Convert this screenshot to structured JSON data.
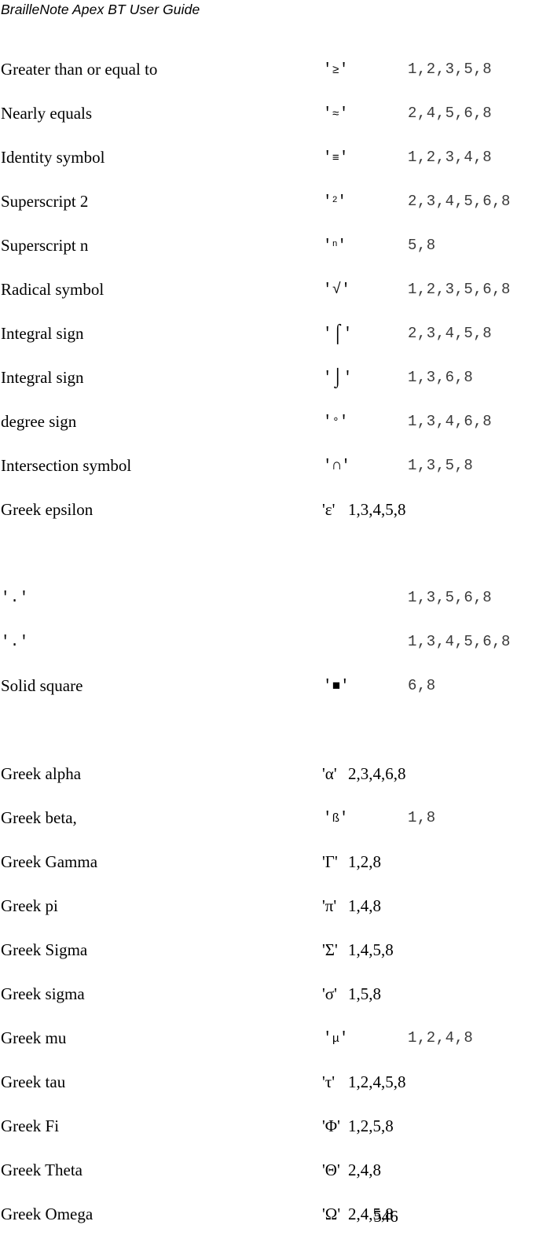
{
  "header": {
    "title": "BrailleNote Apex BT User Guide"
  },
  "page_number": "546",
  "rows": [
    {
      "description": "Greater than or equal to",
      "symbol": "≥",
      "dots": "1,2,3,5,8",
      "style": "mono",
      "glyph_class": "glyph"
    },
    {
      "description": "Nearly equals",
      "symbol": "≈",
      "dots": "2,4,5,6,8",
      "style": "mono",
      "glyph_class": "glyph"
    },
    {
      "description": "Identity symbol",
      "symbol": "≡",
      "dots": "1,2,3,4,8",
      "style": "mono",
      "glyph_class": "glyph"
    },
    {
      "description": "Superscript 2",
      "symbol": "2",
      "dots": "2,3,4,5,6,8",
      "style": "mono",
      "glyph_class": "glyph sup"
    },
    {
      "description": "Superscript n",
      "symbol": "n",
      "dots": "5,8",
      "style": "mono",
      "glyph_class": "glyph sup"
    },
    {
      "description": "Radical symbol",
      "symbol": "√",
      "dots": "1,2,3,5,6,8",
      "style": "mono",
      "glyph_class": "glyph big"
    },
    {
      "description": "Integral sign",
      "symbol": "⌠",
      "dots": "2,3,4,5,8",
      "style": "mono",
      "glyph_class": "glyph tall"
    },
    {
      "description": "Integral sign",
      "symbol": "⌡",
      "dots": "1,3,6,8",
      "style": "mono",
      "glyph_class": "glyph tall"
    },
    {
      "description": "degree sign",
      "symbol": "°",
      "dots": "1,3,4,6,8",
      "style": "mono",
      "glyph_class": "glyph"
    },
    {
      "description": "Intersection symbol",
      "symbol": "∩",
      "dots": "1,3,5,8",
      "style": "mono",
      "glyph_class": "glyph big"
    },
    {
      "description": "Greek epsilon",
      "symbol": "ε",
      "dots": "1,3,4,5,8",
      "style": "serif",
      "glyph_class": "glyph"
    },
    {
      "description": "",
      "symbol": "",
      "dots": "",
      "style": "spacer",
      "glyph_class": ""
    },
    {
      "description": "'.'",
      "symbol": "",
      "dots": "1,3,5,6,8",
      "style": "mono-left",
      "glyph_class": ""
    },
    {
      "description": "'.'",
      "symbol": "",
      "dots": "1,3,4,5,6,8",
      "style": "mono-left",
      "glyph_class": ""
    },
    {
      "description": "Solid square",
      "symbol": "■",
      "dots": "6,8",
      "style": "mono",
      "glyph_class": "glyph sq"
    },
    {
      "description": "",
      "symbol": "",
      "dots": "",
      "style": "spacer",
      "glyph_class": ""
    },
    {
      "description": "Greek alpha",
      "symbol": "α",
      "dots": "2,3,4,6,8",
      "style": "serif",
      "glyph_class": "glyph"
    },
    {
      "description": "Greek beta,",
      "symbol": "ß",
      "dots": "1,8",
      "style": "mono",
      "glyph_class": "glyph"
    },
    {
      "description": "Greek Gamma",
      "symbol": "Γ",
      "dots": "1,2,8",
      "style": "serif",
      "glyph_class": "glyph"
    },
    {
      "description": "Greek pi",
      "symbol": "π",
      "dots": "1,4,8",
      "style": "serif",
      "glyph_class": "glyph"
    },
    {
      "description": "Greek Sigma",
      "symbol": "Σ",
      "dots": "1,4,5,8",
      "style": "serif",
      "glyph_class": "glyph"
    },
    {
      "description": "Greek sigma",
      "symbol": "σ",
      "dots": "1,5,8",
      "style": "serif",
      "glyph_class": "glyph"
    },
    {
      "description": "Greek mu",
      "symbol": "μ",
      "dots": "1,2,4,8",
      "style": "mono",
      "glyph_class": "glyph"
    },
    {
      "description": "Greek tau",
      "symbol": "τ",
      "dots": "1,2,4,5,8",
      "style": "serif",
      "glyph_class": "glyph"
    },
    {
      "description": "Greek Fi",
      "symbol": "Φ",
      "dots": "1,2,5,8",
      "style": "serif",
      "glyph_class": "glyph"
    },
    {
      "description": "Greek Theta",
      "symbol": "Θ",
      "dots": "2,4,8",
      "style": "serif",
      "glyph_class": "glyph"
    },
    {
      "description": "Greek Omega",
      "symbol": "Ω",
      "dots": "2,4,5,8",
      "style": "serif",
      "glyph_class": "glyph"
    }
  ],
  "quote_char": "'"
}
